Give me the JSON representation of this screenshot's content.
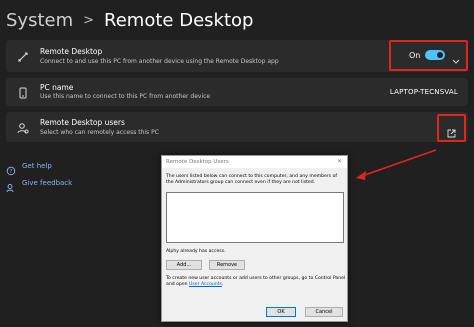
{
  "header": {
    "parent": "System",
    "separator": ">",
    "title": "Remote Desktop"
  },
  "remote_desktop": {
    "title": "Remote Desktop",
    "description": "Connect to and use this PC from another device using the Remote Desktop app",
    "toggle_label": "On",
    "toggle_state": true,
    "accent_color": "#4cc2ff"
  },
  "pc_name": {
    "title": "PC name",
    "description": "Use this name to connect to this PC from another device",
    "value": "LAPTOP-TECNSVAL"
  },
  "remote_users": {
    "title": "Remote Desktop users",
    "description": "Select who can remotely access this PC"
  },
  "links": {
    "help": "Get help",
    "feedback": "Give feedback"
  },
  "highlight_color": "#e0261b",
  "dialog": {
    "title": "Remote Desktop Users",
    "close": "✕",
    "info": "The users listed below can connect to this computer, and any members of the Administrators group can connect even if they are not listed.",
    "access_text": "Alphy already has access.",
    "add_label": "Add...",
    "remove_label": "Remove",
    "create_text_before": "To create new user accounts or add users to other groups, go to Control Panel and open ",
    "create_link": "User Accounts",
    "create_text_after": ".",
    "ok_label": "OK",
    "cancel_label": "Cancel"
  }
}
